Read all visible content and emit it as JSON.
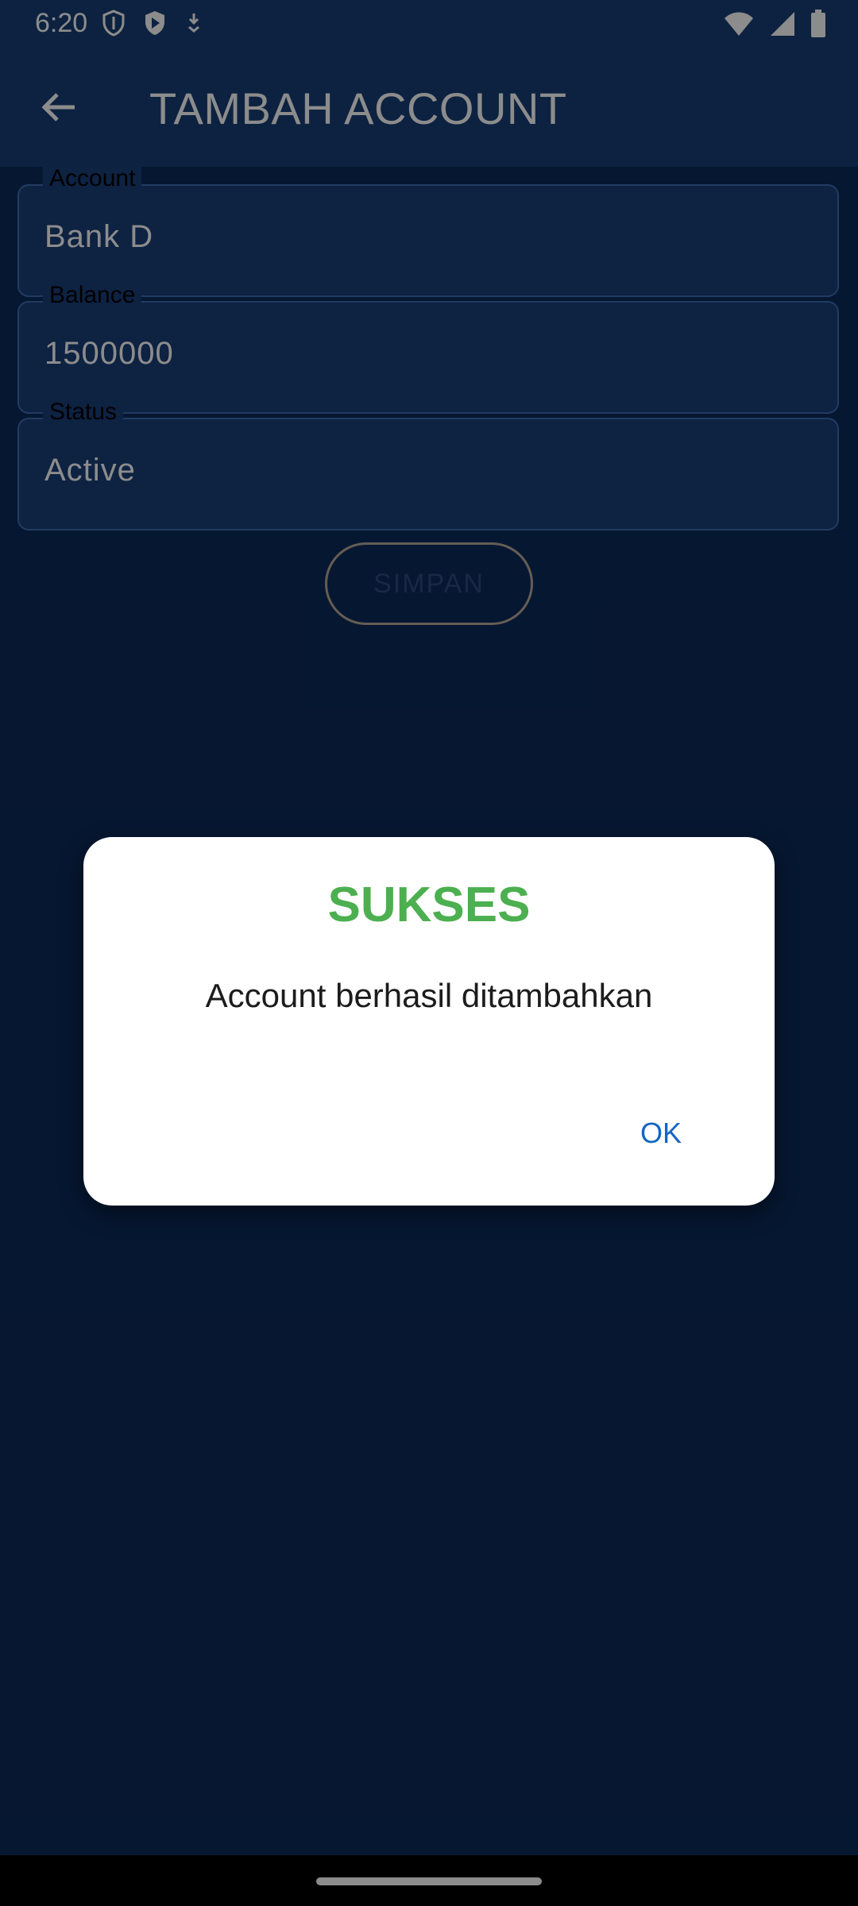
{
  "status_bar": {
    "time": "6:20",
    "left_icons": [
      "shield-icon",
      "play-protect-icon",
      "download-icon"
    ],
    "right_icons": [
      "wifi-icon",
      "signal-icon",
      "battery-icon"
    ]
  },
  "app_bar": {
    "back_icon": "arrow-left-icon",
    "title": "TAMBAH ACCOUNT"
  },
  "form": {
    "account": {
      "label": "Account",
      "value": "Bank D"
    },
    "balance": {
      "label": "Balance",
      "value": "1500000"
    },
    "status": {
      "label": "Status",
      "value": "Active"
    },
    "save_label": "SIMPAN"
  },
  "dialog": {
    "title": "SUKSES",
    "message": "Account berhasil ditambahkan",
    "ok_label": "OK"
  },
  "colors": {
    "background": "#0c2a5a",
    "app_bar": "#173e76",
    "success": "#4caf50",
    "accent": "#1565c0"
  }
}
